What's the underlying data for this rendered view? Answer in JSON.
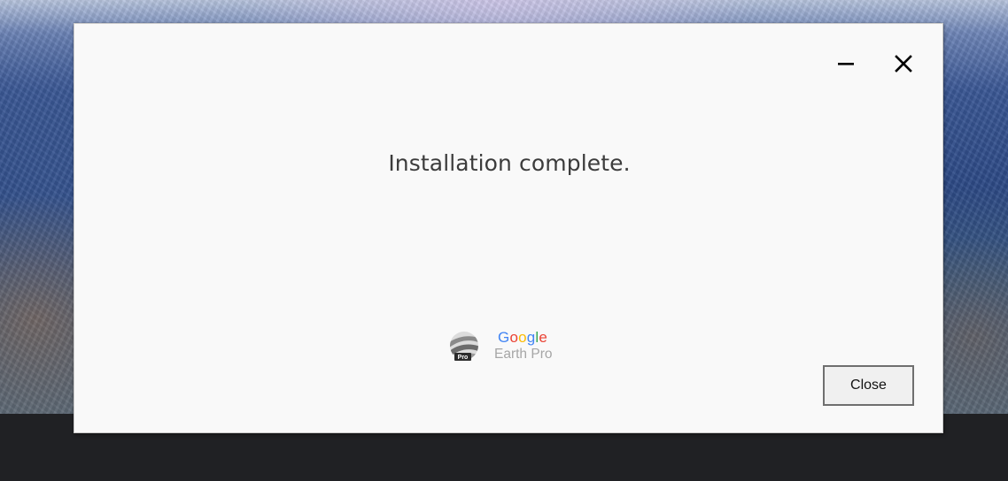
{
  "dialog": {
    "message": "Installation complete.",
    "close_button_label": "Close"
  },
  "titlebar": {
    "minimize_icon": "minimize-icon",
    "close_icon": "close-icon"
  },
  "brand": {
    "logo_icon": "google-earth-pro-logo",
    "logo_badge": "Pro",
    "google_letters": [
      {
        "char": "G",
        "color": "#4285F4"
      },
      {
        "char": "o",
        "color": "#EA4335"
      },
      {
        "char": "o",
        "color": "#FBBC05"
      },
      {
        "char": "g",
        "color": "#4285F4"
      },
      {
        "char": "l",
        "color": "#34A853"
      },
      {
        "char": "e",
        "color": "#EA4335"
      }
    ],
    "product": "Earth Pro"
  }
}
